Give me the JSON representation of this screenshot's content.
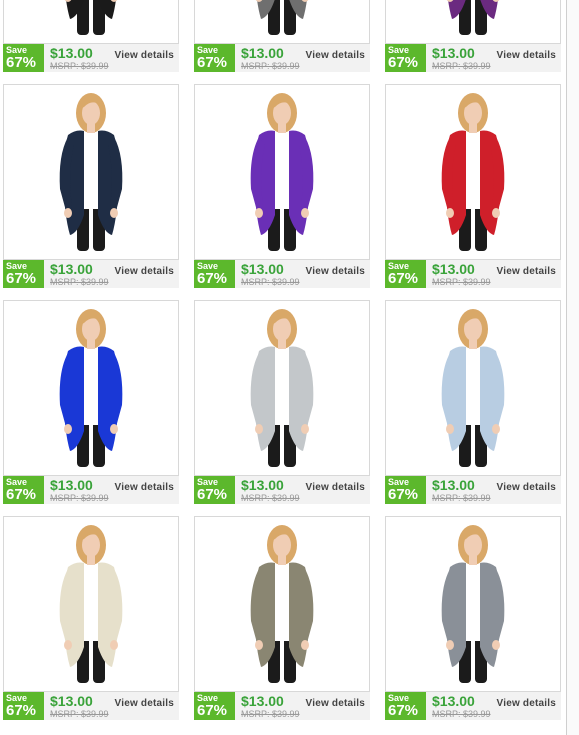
{
  "product_grid": {
    "products": [
      {
        "color": "#1a1a1a",
        "price": "$13.00",
        "msrp": "MSRP: $39.99",
        "save_label": "Save",
        "save_pct": "67%",
        "view_label": "View details"
      },
      {
        "color": "#6f6f6f",
        "price": "$13.00",
        "msrp": "MSRP: $39.99",
        "save_label": "Save",
        "save_pct": "67%",
        "view_label": "View details"
      },
      {
        "color": "#6b2a80",
        "price": "$13.00",
        "msrp": "MSRP: $39.99",
        "save_label": "Save",
        "save_pct": "67%",
        "view_label": "View details"
      },
      {
        "color": "#1f2d45",
        "price": "$13.00",
        "msrp": "MSRP: $39.99",
        "save_label": "Save",
        "save_pct": "67%",
        "view_label": "View details"
      },
      {
        "color": "#6a2fb6",
        "price": "$13.00",
        "msrp": "MSRP: $39.99",
        "save_label": "Save",
        "save_pct": "67%",
        "view_label": "View details"
      },
      {
        "color": "#cf1f2a",
        "price": "$13.00",
        "msrp": "MSRP: $39.99",
        "save_label": "Save",
        "save_pct": "67%",
        "view_label": "View details"
      },
      {
        "color": "#1a38d6",
        "price": "$13.00",
        "msrp": "MSRP: $39.99",
        "save_label": "Save",
        "save_pct": "67%",
        "view_label": "View details"
      },
      {
        "color": "#c3c7ca",
        "price": "$13.00",
        "msrp": "MSRP: $39.99",
        "save_label": "Save",
        "save_pct": "67%",
        "view_label": "View details"
      },
      {
        "color": "#b8cde2",
        "price": "$13.00",
        "msrp": "MSRP: $39.99",
        "save_label": "Save",
        "save_pct": "67%",
        "view_label": "View details"
      },
      {
        "color": "#e6e0cb",
        "price": "$13.00",
        "msrp": "MSRP: $39.99",
        "save_label": "Save",
        "save_pct": "67%",
        "view_label": "View details"
      },
      {
        "color": "#8a8672",
        "price": "$13.00",
        "msrp": "MSRP: $39.99",
        "save_label": "Save",
        "save_pct": "67%",
        "view_label": "View details"
      },
      {
        "color": "#8a9098",
        "price": "$13.00",
        "msrp": "MSRP: $39.99",
        "save_label": "Save",
        "save_pct": "67%",
        "view_label": "View details"
      }
    ]
  },
  "colors": {
    "badge_green": "#5cb82c",
    "price_green": "#3aa33a",
    "skin": "#f0cdb4",
    "hair": "#d9a868",
    "pants": "#1b1b1b",
    "undershirt": "#ffffff"
  }
}
